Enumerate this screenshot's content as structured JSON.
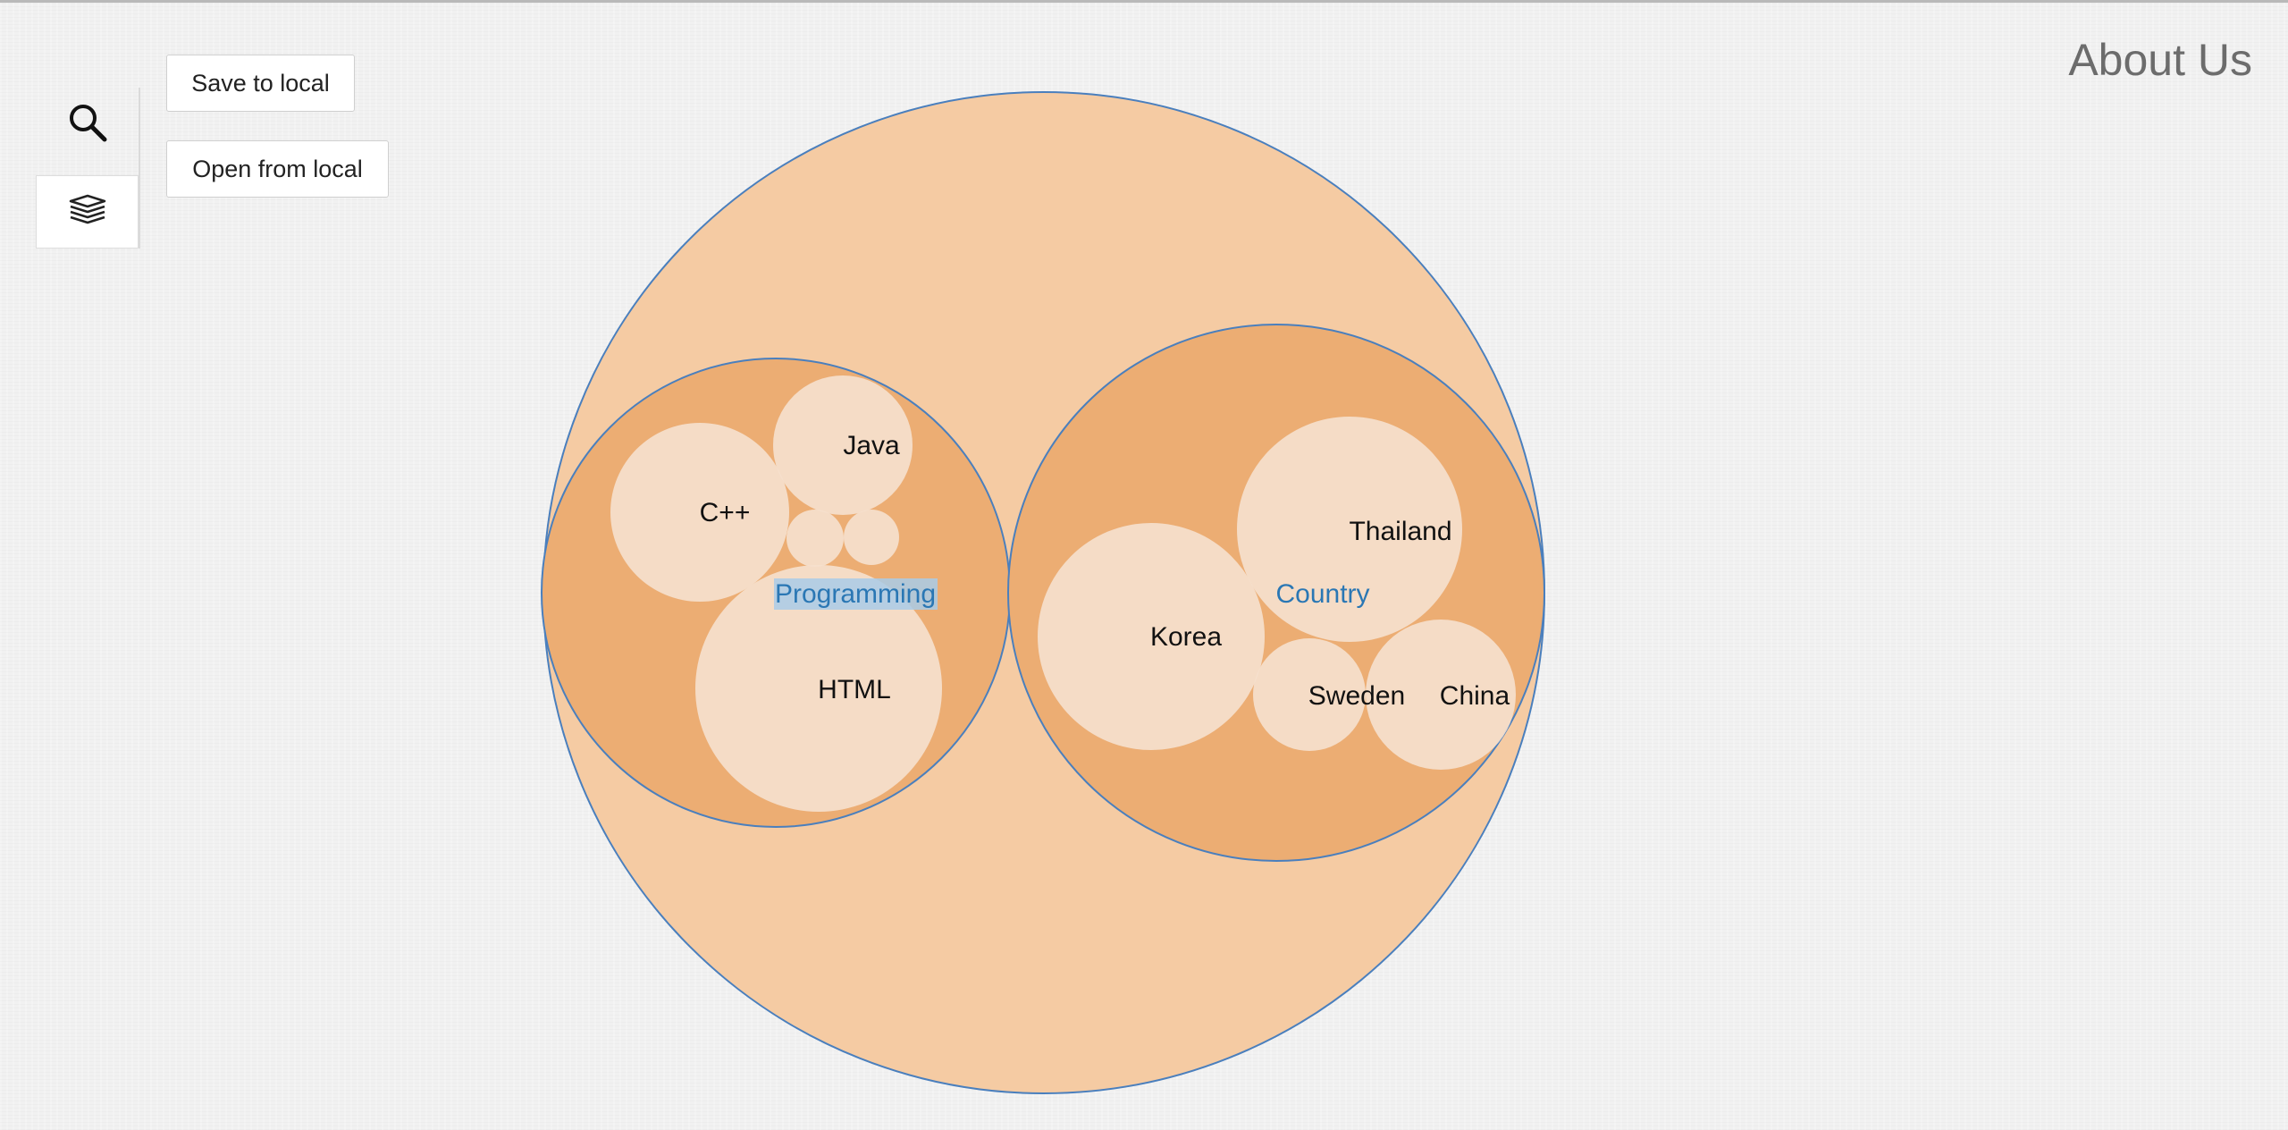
{
  "header": {
    "about_label": "About Us"
  },
  "toolbar": {
    "search_icon": "search-icon",
    "layers_icon": "layers-icon",
    "save_label": "Save to local",
    "open_label": "Open from local"
  },
  "colors": {
    "root_fill": "#f5cba3",
    "group_fill": "#ecad73",
    "leaf_fill": "#f5dfcd",
    "stroke": "#4a7fbd",
    "group_label": "#2a77b4",
    "highlight": "#a9cbe8"
  },
  "chart_data": {
    "type": "circle-packing",
    "highlighted_label": "Programming",
    "groups": [
      {
        "name": "Programming",
        "children": [
          {
            "name": "C++"
          },
          {
            "name": "Java"
          },
          {
            "name": "HTML"
          },
          {
            "name": ""
          },
          {
            "name": ""
          }
        ]
      },
      {
        "name": "Country",
        "children": [
          {
            "name": "Thailand"
          },
          {
            "name": "Korea"
          },
          {
            "name": "Sweden"
          },
          {
            "name": "China"
          }
        ]
      }
    ]
  }
}
